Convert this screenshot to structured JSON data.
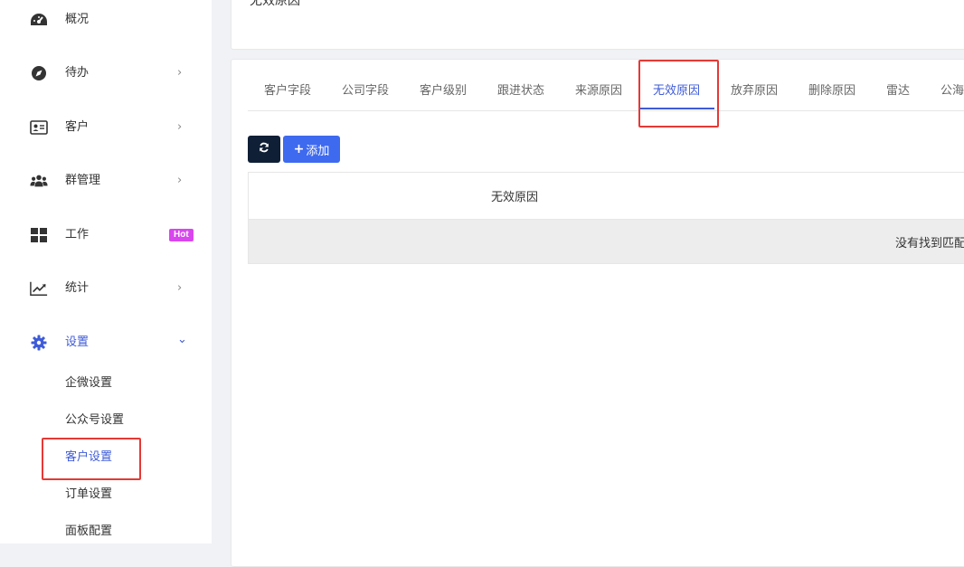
{
  "sidebar": {
    "items": [
      {
        "label": "概况",
        "icon": "dashboard-icon"
      },
      {
        "label": "待办",
        "icon": "compass-icon",
        "arrow": "›"
      },
      {
        "label": "客户",
        "icon": "id-card-icon",
        "arrow": "›"
      },
      {
        "label": "群管理",
        "icon": "users-icon",
        "arrow": "›"
      },
      {
        "label": "工作",
        "icon": "grid-icon",
        "badge": "Hot"
      },
      {
        "label": "统计",
        "icon": "line-chart-icon",
        "arrow": "›"
      },
      {
        "label": "设置",
        "icon": "gear-icon",
        "arrow": "⌄"
      }
    ],
    "settings_sub": [
      {
        "label": "企微设置"
      },
      {
        "label": "公众号设置"
      },
      {
        "label": "客户设置"
      },
      {
        "label": "订单设置"
      },
      {
        "label": "面板配置"
      }
    ]
  },
  "top_card": {
    "title": "无效原因"
  },
  "tabs": [
    {
      "label": "客户字段"
    },
    {
      "label": "公司字段"
    },
    {
      "label": "客户级别"
    },
    {
      "label": "跟进状态"
    },
    {
      "label": "来源原因"
    },
    {
      "label": "无效原因"
    },
    {
      "label": "放弃原因"
    },
    {
      "label": "删除原因"
    },
    {
      "label": "雷达"
    },
    {
      "label": "公海"
    }
  ],
  "toolbar": {
    "add_label": "添加"
  },
  "table": {
    "column": "无效原因",
    "empty_text": "没有找到匹配"
  },
  "colors": {
    "accent": "#3e5bd8",
    "add_button": "#3e6af0",
    "refresh_button": "#0f1f36",
    "hot_badge": "#d946ef",
    "highlight_box": "#e53935"
  }
}
